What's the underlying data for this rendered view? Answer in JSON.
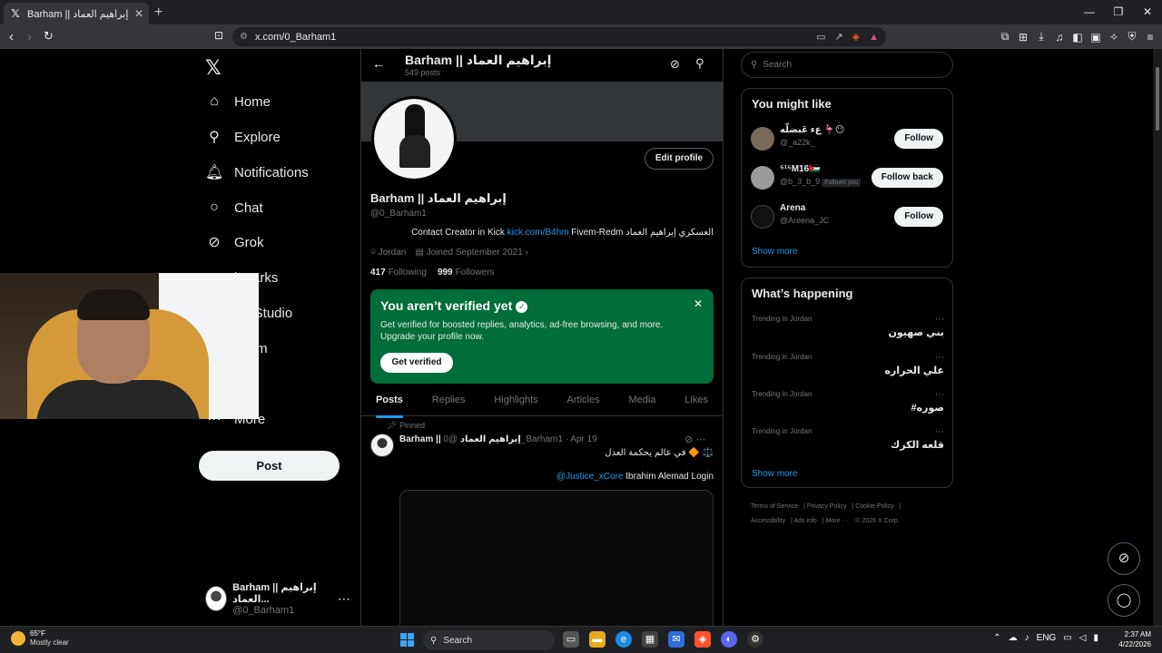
{
  "browser": {
    "tab_title": "Barham || إبراهيم العماد (@0_Barham1) / X",
    "url": "x.com/0_Barham1"
  },
  "nav": {
    "items": [
      {
        "label": "Home",
        "icon": "home-icon"
      },
      {
        "label": "Explore",
        "icon": "search-icon"
      },
      {
        "label": "Notifications",
        "icon": "bell-icon"
      },
      {
        "label": "Chat",
        "icon": "chat-icon"
      },
      {
        "label": "Grok",
        "icon": "grok-icon"
      },
      {
        "label": "kmarks",
        "icon": "bookmark-icon"
      },
      {
        "label": "tor Studio",
        "icon": "studio-icon"
      },
      {
        "label": "mium",
        "icon": "premium-icon"
      },
      {
        "label": "file",
        "icon": "profile-icon"
      },
      {
        "label": "More",
        "icon": "more-icon"
      }
    ],
    "post_label": "Post",
    "account_name": "Barham || إبراهيم العماد...",
    "account_handle": "@0_Barham1"
  },
  "profile": {
    "header_name": "Barham || إبراهيم العماد",
    "post_count": "549 posts",
    "edit_label": "Edit profile",
    "name": "Barham || إبراهيم العماد",
    "handle": "@0_Barham1",
    "bio_prefix": "Contact Creator in Kick ",
    "bio_link": "kick.com/B4hm",
    "bio_suffix": "  Fivem-Redm العسكري إبراهيم العماد",
    "location": "Jordan",
    "joined": "Joined September 2021",
    "following_count": "417",
    "following_label": "Following",
    "followers_count": "999",
    "followers_label": "Followers"
  },
  "verify": {
    "title": "You aren’t verified yet",
    "desc": "Get verified for boosted replies, analytics, ad-free browsing, and more. Upgrade your profile now.",
    "button": "Get verified"
  },
  "tabs": [
    "Posts",
    "Replies",
    "Highlights",
    "Articles",
    "Media",
    "Likes"
  ],
  "tweet": {
    "pinned": "Pinned",
    "author": "Barham || إبراهيم العماد",
    "meta": "@0_Barham1 · Apr 19",
    "line1": "في عالم يحكمة العدل 🔶 ⚖️",
    "mention": "@Justice_xCore",
    "line2": " Ibrahim Alemad Login"
  },
  "right": {
    "search_placeholder": "Search",
    "might_like_title": "You might like",
    "suggestions": [
      {
        "name": "عء عَبضلّه 🦩😶",
        "handle": "@_a22k_",
        "follows_you": "",
        "button": "Follow"
      },
      {
        "name": "⁵¹⁵M16🇯🇴",
        "handle": "@b_3_b_9",
        "follows_you": "Follows you",
        "button": "Follow back"
      },
      {
        "name": "Arena",
        "handle": "@Areena_JC",
        "follows_you": "",
        "button": "Follow"
      }
    ],
    "show_more": "Show more",
    "happening_title": "What’s happening",
    "trends": [
      {
        "context": "Trending in Jordan",
        "topic": "بني صهيون"
      },
      {
        "context": "Trending in Jordan",
        "topic": "علي الحراره"
      },
      {
        "context": "Trending in Jordan",
        "topic": "#صوره"
      },
      {
        "context": "Trending in Jordan",
        "topic": "قلعه الكرك"
      }
    ],
    "footer": [
      "Terms of Service",
      "Privacy Policy",
      "Cookie Policy",
      "Accessibility",
      "Ads info",
      "More ···",
      "© 2026 X Corp."
    ]
  },
  "taskbar": {
    "temp": "65°F",
    "condition": "Mostly clear",
    "search": "Search",
    "lang": "ENG",
    "time": "2:37 AM",
    "date": "4/22/2026"
  }
}
